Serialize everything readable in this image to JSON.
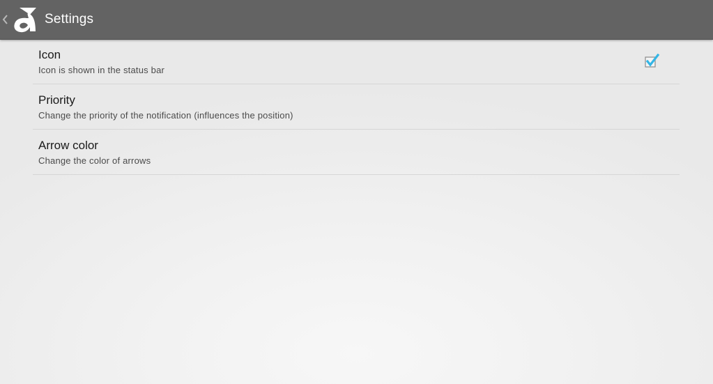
{
  "action_bar": {
    "title": "Settings",
    "up_icon": "chevron-left-icon",
    "logo_icon": "app-logo-icon"
  },
  "preferences": [
    {
      "title": "Icon",
      "summary": "Icon is shown in the status bar",
      "has_checkbox": true,
      "checked": true
    },
    {
      "title": "Priority",
      "summary": "Change the priority of the notification (influences the position)"
    },
    {
      "title": "Arrow color",
      "summary": "Change the color of arrows"
    }
  ],
  "colors": {
    "action_bar": "#636363",
    "checkbox_accent": "#33b5e5",
    "divider": "#d6d6d6"
  }
}
